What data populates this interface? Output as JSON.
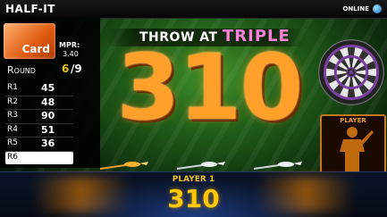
{
  "header": {
    "title": "HALF-IT",
    "status": "ONLINE",
    "status_icon": "globe-icon"
  },
  "stats": {
    "card_label": "Card",
    "mpr_label": "MPR:",
    "mpr_value": "3.40",
    "round_label": "Round",
    "round_current": "6",
    "round_total": "/9",
    "rounds": [
      {
        "label": "R1",
        "score": "45"
      },
      {
        "label": "R2",
        "score": "48"
      },
      {
        "label": "R3",
        "score": "90"
      },
      {
        "label": "R4",
        "score": "51"
      },
      {
        "label": "R5",
        "score": "36"
      },
      {
        "label": "R6",
        "score": ""
      }
    ],
    "active_round_index": 5
  },
  "main": {
    "throw_label": "THROW AT",
    "target": "TRIPLE",
    "score": "310"
  },
  "player_panel": {
    "label": "PLAYER"
  },
  "darts": {
    "thrown": 1,
    "total": 3
  },
  "footer": {
    "player_name": "PLAYER 1",
    "score": "310"
  },
  "colors": {
    "background_green": "#2a7a20",
    "score_orange": "#ffa02a",
    "target_pink": "#ff80d8",
    "round_gold": "#f0c020",
    "footer_navy": "#0a1428"
  }
}
